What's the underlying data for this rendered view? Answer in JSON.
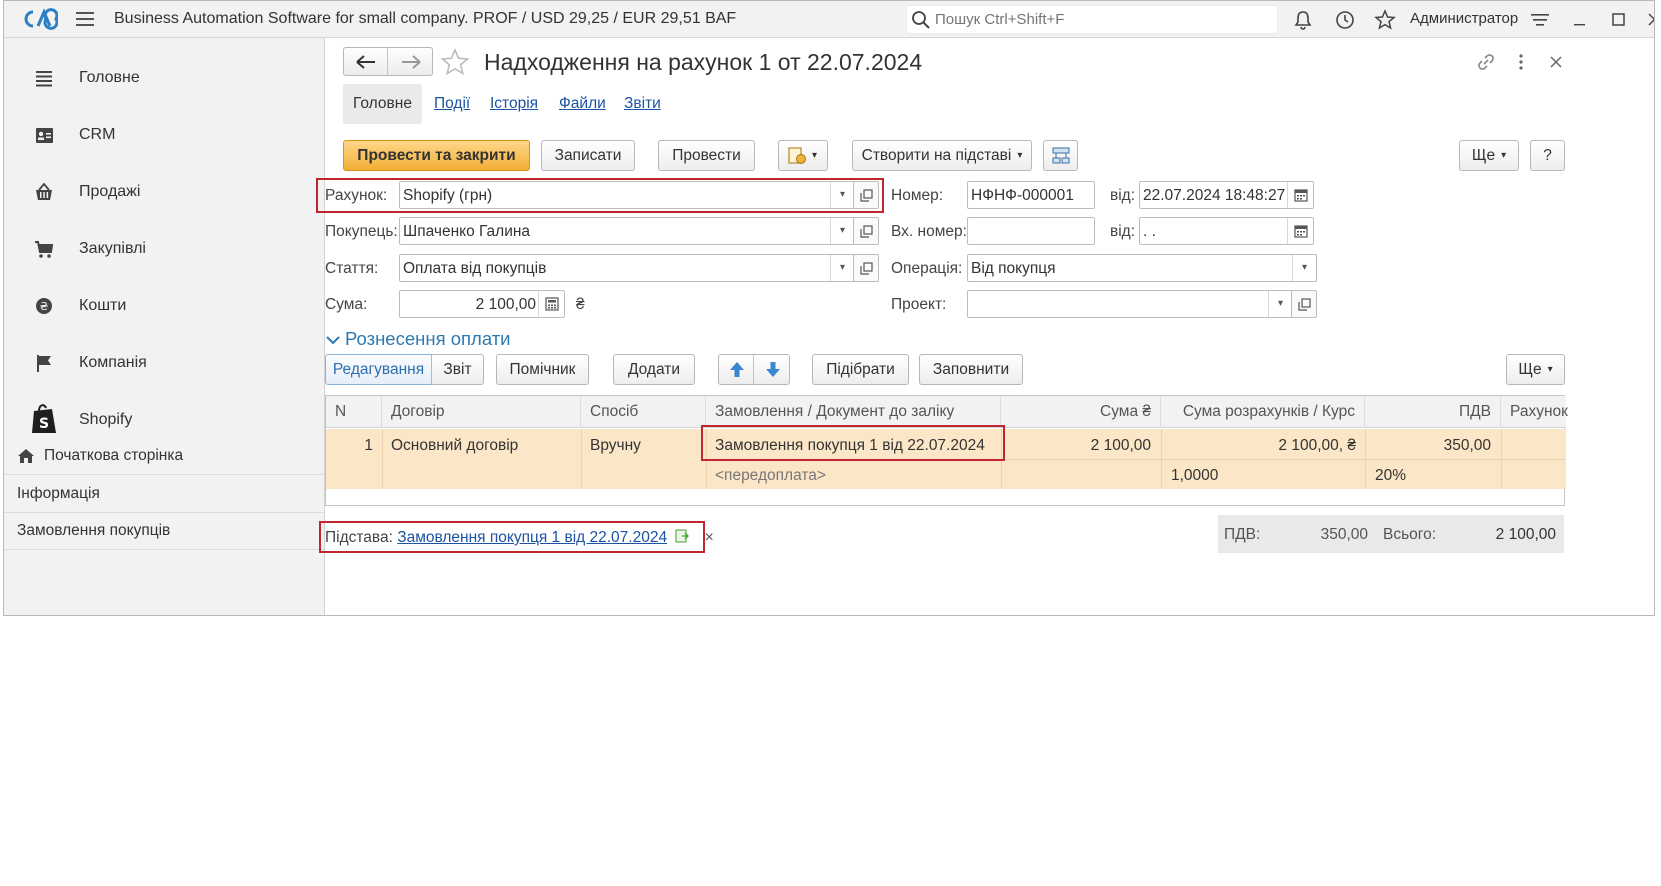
{
  "app": {
    "title": "Business Automation Software for small company. PROF / USD 29,25 / EUR 29,51 BAF",
    "search_placeholder": "Пошук Ctrl+Shift+F",
    "user": "Администратор"
  },
  "sidebar": {
    "items": [
      {
        "label": "Головне",
        "icon": "menu-lines-icon"
      },
      {
        "label": "CRM",
        "icon": "contact-card-icon"
      },
      {
        "label": "Продажі",
        "icon": "shop-basket-icon"
      },
      {
        "label": "Закупівлі",
        "icon": "cart-icon"
      },
      {
        "label": "Кошти",
        "icon": "coin-icon"
      },
      {
        "label": "Компанія",
        "icon": "flag-icon"
      },
      {
        "label": "Shopify",
        "icon": "shopify-bag-icon"
      }
    ],
    "links": [
      "Початкова сторінка",
      "Інформація",
      "Замовлення покупців"
    ]
  },
  "doc": {
    "title": "Надходження на рахунок 1  от 22.07.2024"
  },
  "tabs": [
    "Головне",
    "Події",
    "Історія",
    "Файли",
    "Звіти"
  ],
  "toolbar": {
    "post_close": "Провести та закрити",
    "save": "Записати",
    "post": "Провести",
    "create_based": "Створити на підставі",
    "more": "Ще",
    "help": "?"
  },
  "form": {
    "account_label": "Рахунок:",
    "account_value": "Shopify (грн)",
    "buyer_label": "Покупець:",
    "buyer_value": "Шпаченко Галина",
    "article_label": "Стаття:",
    "article_value": "Оплата від покупців",
    "sum_label": "Сума:",
    "sum_value": "2 100,00",
    "currency": "₴",
    "number_label": "Номер:",
    "number_value": "НФНФ-000001",
    "from_label": "від:",
    "date_value": "22.07.2024 18:48:27",
    "in_number_label": "Вх. номер:",
    "in_number_value": "",
    "from_label2": "від:",
    "in_date_value": " .  .",
    "operation_label": "Операція:",
    "operation_value": "Від покупця",
    "project_label": "Проект:",
    "project_value": ""
  },
  "section": {
    "title": "Рознесення оплати",
    "edit_tab": "Редагування",
    "report_tab": "Звіт",
    "helper": "Помічник",
    "add": "Додати",
    "pick": "Підібрати",
    "fill": "Заповнити",
    "more": "Ще"
  },
  "table": {
    "columns": [
      "N",
      "Договір",
      "Спосіб",
      "Замовлення / Документ до заліку",
      "Сума ₴",
      "Сума розрахунків / Курс",
      "ПДВ",
      "Рахунок"
    ],
    "rows": [
      {
        "n": "1",
        "contract": "Основний договір",
        "method": "Вручну",
        "order": "Замовлення покупця 1 від 22.07.2024",
        "order_sub": "<передоплата>",
        "sum": "2 100,00",
        "settle_sum": "2 100,00, ₴",
        "rate": "1,0000",
        "vat": "350,00",
        "vat_rate": "20%"
      }
    ]
  },
  "totals": {
    "vat_label": "ПДВ:",
    "vat_value": "350,00",
    "total_label": "Всього:",
    "total_value": "2 100,00"
  },
  "basis": {
    "label": "Підстава:",
    "link": "Замовлення покупця 1 від 22.07.2024",
    "close": "×"
  }
}
